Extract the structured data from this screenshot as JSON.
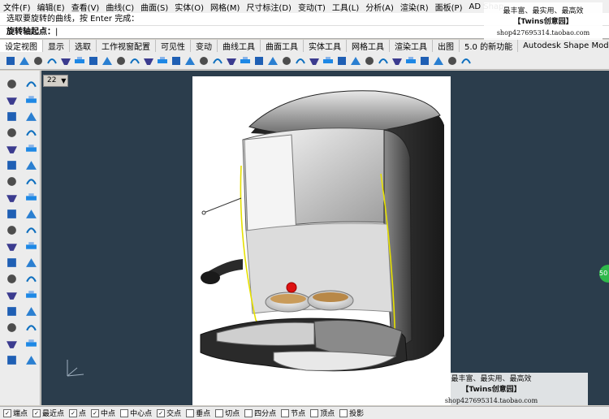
{
  "menubar": {
    "items": [
      "文件(F)",
      "编辑(E)",
      "查看(V)",
      "曲线(C)",
      "曲面(S)",
      "实体(O)",
      "网格(M)",
      "尺寸标注(D)",
      "变动(T)",
      "工具(L)",
      "分析(A)",
      "渲染(R)",
      "面板(P)",
      "AD Shap"
    ]
  },
  "command": {
    "history": "选取要旋转的曲线，按 Enter 完成：",
    "prompt": "旋转轴起点：",
    "caret": "|"
  },
  "tabs": [
    "设定视图",
    "显示",
    "选取",
    "工作视窗配置",
    "可见性",
    "变动",
    "曲线工具",
    "曲面工具",
    "实体工具",
    "网格工具",
    "渲染工具",
    "出图",
    "5.0 的新功能",
    "Autodesk Shape Modeling"
  ],
  "toolbar_icons": [
    "point-icon",
    "curve-icon",
    "surface-icon",
    "revolve-icon",
    "loft-icon",
    "sweep-icon",
    "extrude-icon",
    "patch-icon",
    "blend-icon",
    "fillet-icon",
    "trim-icon",
    "split-icon",
    "join-icon",
    "explode-icon",
    "offset-icon",
    "rebuild-icon",
    "match-icon",
    "network-icon",
    "rail-icon",
    "edge-icon",
    "boolean-icon",
    "shell-icon",
    "cap-icon",
    "mirror-icon",
    "array-icon",
    "rotate-icon",
    "scale-icon",
    "move-icon",
    "copy-icon",
    "lock-icon",
    "hide-icon",
    "show-icon",
    "layer-icon",
    "view-icon"
  ],
  "left_tool_icons": [
    "select-icon",
    "dot-icon",
    "polyline-icon",
    "curve-pts-icon",
    "circle-icon",
    "arc-icon",
    "ellipse-icon",
    "rectangle-icon",
    "polygon-icon",
    "text-icon",
    "curve-edit-icon",
    "fillet-curve-icon",
    "surface-plane-icon",
    "surface-edge-icon",
    "box-icon",
    "sphere-icon",
    "cylinder-icon",
    "cone-icon",
    "boolean-union-icon",
    "boolean-diff-icon",
    "move-tool-icon",
    "copy-tool-icon",
    "rotate-tool-icon",
    "scale-tool-icon",
    "mirror-tool-icon",
    "array-tool-icon",
    "trim-tool-icon",
    "split-tool-icon",
    "group-icon",
    "ungroup-icon",
    "layer-tool-icon",
    "properties-icon",
    "analyze-icon",
    "check-icon",
    "render-icon",
    "material-icon"
  ],
  "viewport": {
    "label": "22",
    "background": "#2b3d4c"
  },
  "watermark_top": {
    "line1": "最丰富、最实用、最高效",
    "line2": "【Twins创意园】",
    "line3": "shop427695314.taobao.com"
  },
  "watermark_bottom": {
    "line1": "最丰富、最实用、最高效",
    "line2": "【Twins创意园】",
    "line3": "shop427695314.taobao.com"
  },
  "side_badge": "50",
  "status": {
    "snaps": [
      {
        "label": "端点",
        "checked": true
      },
      {
        "label": "最近点",
        "checked": true
      },
      {
        "label": "点",
        "checked": true
      },
      {
        "label": "中点",
        "checked": true
      },
      {
        "label": "中心点",
        "checked": false
      },
      {
        "label": "交点",
        "checked": true
      },
      {
        "label": "垂点",
        "checked": false
      },
      {
        "label": "切点",
        "checked": false
      },
      {
        "label": "四分点",
        "checked": false
      },
      {
        "label": "节点",
        "checked": false
      },
      {
        "label": "顶点",
        "checked": false
      },
      {
        "label": "投影",
        "checked": false
      }
    ]
  }
}
